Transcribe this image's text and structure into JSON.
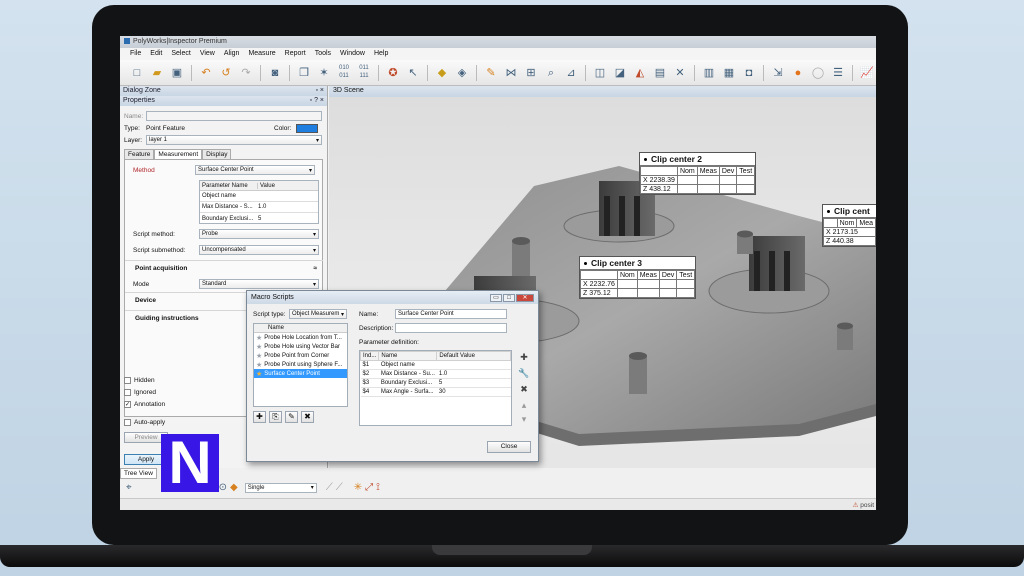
{
  "window": {
    "title": "PolyWorks|Inspector Premium"
  },
  "menu": [
    "File",
    "Edit",
    "Select",
    "View",
    "Align",
    "Measure",
    "Report",
    "Tools",
    "Window",
    "Help"
  ],
  "dialog_zone": {
    "title": "Dialog Zone"
  },
  "properties": {
    "title": "Properties",
    "name_label": "Name:",
    "type_label": "Type:",
    "type_value": "Point Feature",
    "color_label": "Color:",
    "color_value": "#1e7fe0",
    "layer_label": "Layer:",
    "layer_value": "layer 1",
    "tabs": [
      "Feature",
      "Measurement",
      "Display"
    ],
    "method_label": "Method",
    "method_value": "Surface Center Point",
    "param_headers": [
      "Parameter Name",
      "Value"
    ],
    "params": [
      {
        "name": "Object name",
        "value": ""
      },
      {
        "name": "Max Distance - S...",
        "value": "1.0"
      },
      {
        "name": "Boundary Exclusi...",
        "value": "5"
      }
    ],
    "script_method_label": "Script method:",
    "script_method_value": "Probe",
    "script_submethod_label": "Script submethod:",
    "script_submethod_value": "Uncompensated",
    "point_acq": "Point acquisition",
    "mode_label": "Mode",
    "mode_value": "Standard",
    "device": "Device",
    "guiding": "Guiding instructions",
    "hidden": "Hidden",
    "ignored": "Ignored",
    "annotation": "Annotation",
    "auto_apply": "Auto-apply",
    "preview": "Preview",
    "apply": "Apply"
  },
  "scene": {
    "title": "3D Scene",
    "callouts": [
      {
        "title": "Clip center 2",
        "headers": [
          "",
          "Nom",
          "Meas",
          "Dev",
          "Test"
        ],
        "rows": [
          [
            "X",
            "2238.39"
          ],
          [
            "Z",
            "438.12"
          ]
        ]
      },
      {
        "title": "Clip center 3",
        "headers": [
          "",
          "Nom",
          "Meas",
          "Dev",
          "Test"
        ],
        "rows": [
          [
            "X",
            "2232.76"
          ],
          [
            "Z",
            "375.12"
          ]
        ]
      },
      {
        "title": "Clip cent",
        "headers": [
          "",
          "Nom",
          "Mea"
        ],
        "rows": [
          [
            "X",
            "2173.15"
          ],
          [
            "Z",
            "440.38"
          ]
        ]
      }
    ]
  },
  "macro": {
    "title": "Macro Scripts",
    "script_type_label": "Script type:",
    "script_type_value": "Object Measurem",
    "list_header": "Name",
    "items": [
      "Probe Hole Location from T...",
      "Probe Hole using Vector Bar",
      "Probe Point from Corner",
      "Probe Point using Sphere F...",
      "Surface Center Point"
    ],
    "selected_index": 4,
    "name_label": "Name:",
    "name_value": "Surface Center Point",
    "description_label": "Description:",
    "param_def_label": "Parameter definition:",
    "param_headers": [
      "Ind...",
      "Name",
      "Default Value"
    ],
    "params": [
      [
        "$1",
        "Object name",
        ""
      ],
      [
        "$2",
        "Max Distance - Su...",
        "1.0"
      ],
      [
        "$3",
        "Boundary Exclusi...",
        "5"
      ],
      [
        "$4",
        "Max Angle - Surfa...",
        "30"
      ]
    ],
    "close": "Close"
  },
  "bottom": {
    "tree_view": "Tree View",
    "mode_value": "Single",
    "status_right": "posit"
  },
  "brand_letter": "N"
}
